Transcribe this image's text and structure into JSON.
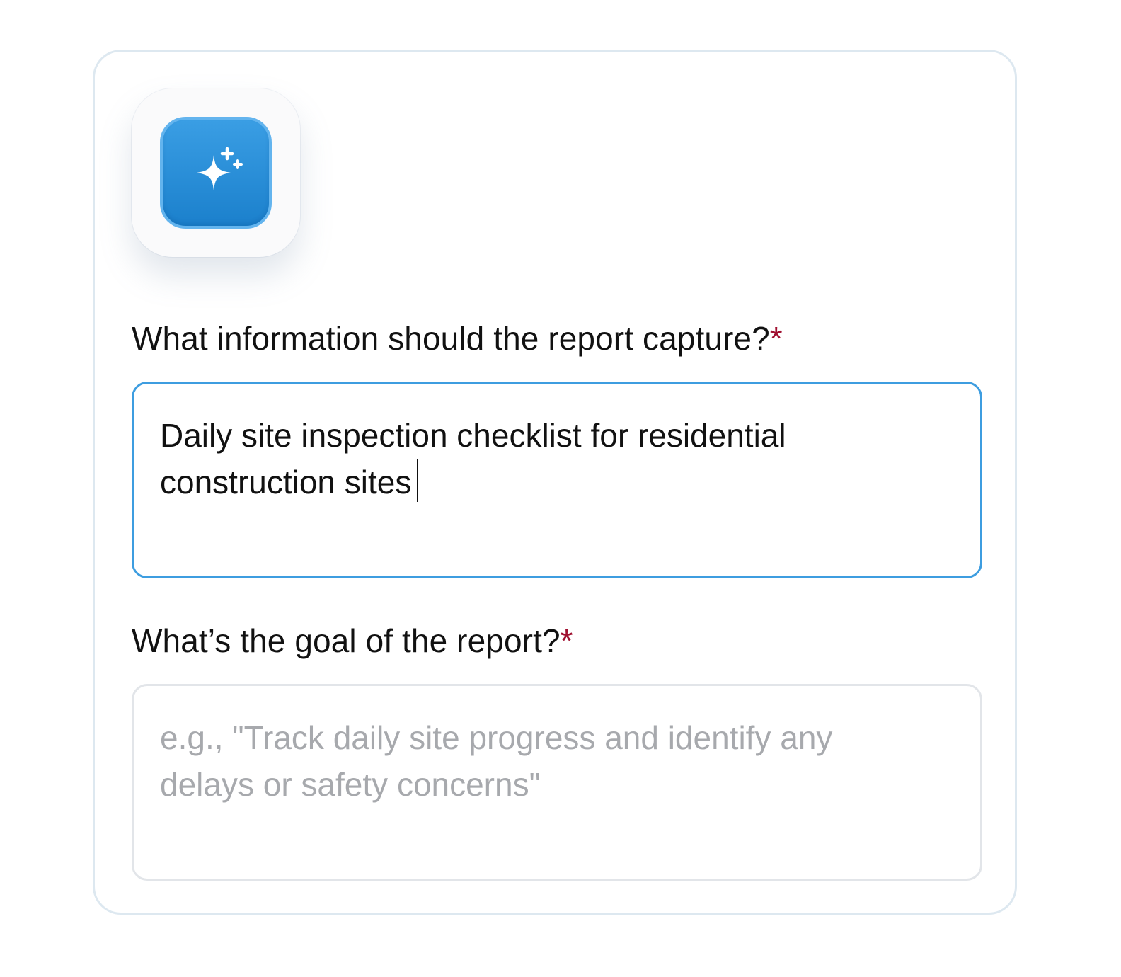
{
  "app_icon": {
    "icon": "sparkle-icon",
    "accent_color": "#2b8fd9"
  },
  "fields": [
    {
      "label": "What information should the report capture?",
      "required_mark": "*",
      "value": "Daily site inspection checklist for residential construction sites",
      "placeholder": "",
      "focused": true
    },
    {
      "label": "What’s the goal of the report?",
      "required_mark": "*",
      "value": "",
      "placeholder": "e.g., \"Track daily site progress and identify any delays or safety concerns\"",
      "focused": false
    }
  ],
  "colors": {
    "focus_border": "#3d9de0",
    "required_mark": "#a01030",
    "placeholder_text": "#a7a9ad",
    "card_border": "#dde8f0"
  }
}
